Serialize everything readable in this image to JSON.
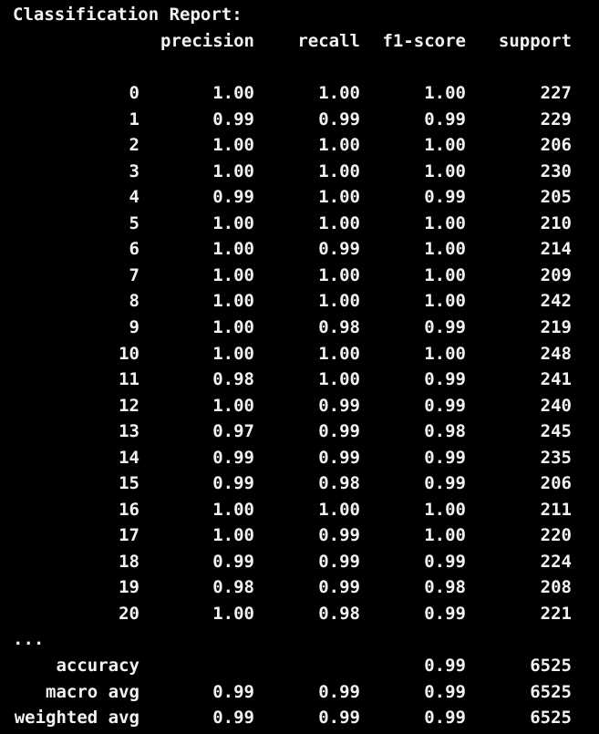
{
  "title": "Classification Report:",
  "headers": {
    "precision": "precision",
    "recall": "recall",
    "f1_score": "f1-score",
    "support": "support"
  },
  "rows": [
    {
      "label": "0",
      "precision": "1.00",
      "recall": "1.00",
      "f1_score": "1.00",
      "support": "227"
    },
    {
      "label": "1",
      "precision": "0.99",
      "recall": "0.99",
      "f1_score": "0.99",
      "support": "229"
    },
    {
      "label": "2",
      "precision": "1.00",
      "recall": "1.00",
      "f1_score": "1.00",
      "support": "206"
    },
    {
      "label": "3",
      "precision": "1.00",
      "recall": "1.00",
      "f1_score": "1.00",
      "support": "230"
    },
    {
      "label": "4",
      "precision": "0.99",
      "recall": "1.00",
      "f1_score": "0.99",
      "support": "205"
    },
    {
      "label": "5",
      "precision": "1.00",
      "recall": "1.00",
      "f1_score": "1.00",
      "support": "210"
    },
    {
      "label": "6",
      "precision": "1.00",
      "recall": "0.99",
      "f1_score": "1.00",
      "support": "214"
    },
    {
      "label": "7",
      "precision": "1.00",
      "recall": "1.00",
      "f1_score": "1.00",
      "support": "209"
    },
    {
      "label": "8",
      "precision": "1.00",
      "recall": "1.00",
      "f1_score": "1.00",
      "support": "242"
    },
    {
      "label": "9",
      "precision": "1.00",
      "recall": "0.98",
      "f1_score": "0.99",
      "support": "219"
    },
    {
      "label": "10",
      "precision": "1.00",
      "recall": "1.00",
      "f1_score": "1.00",
      "support": "248"
    },
    {
      "label": "11",
      "precision": "0.98",
      "recall": "1.00",
      "f1_score": "0.99",
      "support": "241"
    },
    {
      "label": "12",
      "precision": "1.00",
      "recall": "0.99",
      "f1_score": "0.99",
      "support": "240"
    },
    {
      "label": "13",
      "precision": "0.97",
      "recall": "0.99",
      "f1_score": "0.98",
      "support": "245"
    },
    {
      "label": "14",
      "precision": "0.99",
      "recall": "0.99",
      "f1_score": "0.99",
      "support": "235"
    },
    {
      "label": "15",
      "precision": "0.99",
      "recall": "0.98",
      "f1_score": "0.99",
      "support": "206"
    },
    {
      "label": "16",
      "precision": "1.00",
      "recall": "1.00",
      "f1_score": "1.00",
      "support": "211"
    },
    {
      "label": "17",
      "precision": "1.00",
      "recall": "0.99",
      "f1_score": "1.00",
      "support": "220"
    },
    {
      "label": "18",
      "precision": "0.99",
      "recall": "0.99",
      "f1_score": "0.99",
      "support": "224"
    },
    {
      "label": "19",
      "precision": "0.98",
      "recall": "0.99",
      "f1_score": "0.98",
      "support": "208"
    },
    {
      "label": "20",
      "precision": "1.00",
      "recall": "0.98",
      "f1_score": "0.99",
      "support": "221"
    }
  ],
  "ellipsis": "...",
  "summary": [
    {
      "label": "accuracy",
      "precision": "",
      "recall": "",
      "f1_score": "0.99",
      "support": "6525"
    },
    {
      "label": "macro avg",
      "precision": "0.99",
      "recall": "0.99",
      "f1_score": "0.99",
      "support": "6525"
    },
    {
      "label": "weighted avg",
      "precision": "0.99",
      "recall": "0.99",
      "f1_score": "0.99",
      "support": "6525"
    }
  ],
  "colors": {
    "background": "#000000",
    "text": "#f2f2f2"
  }
}
